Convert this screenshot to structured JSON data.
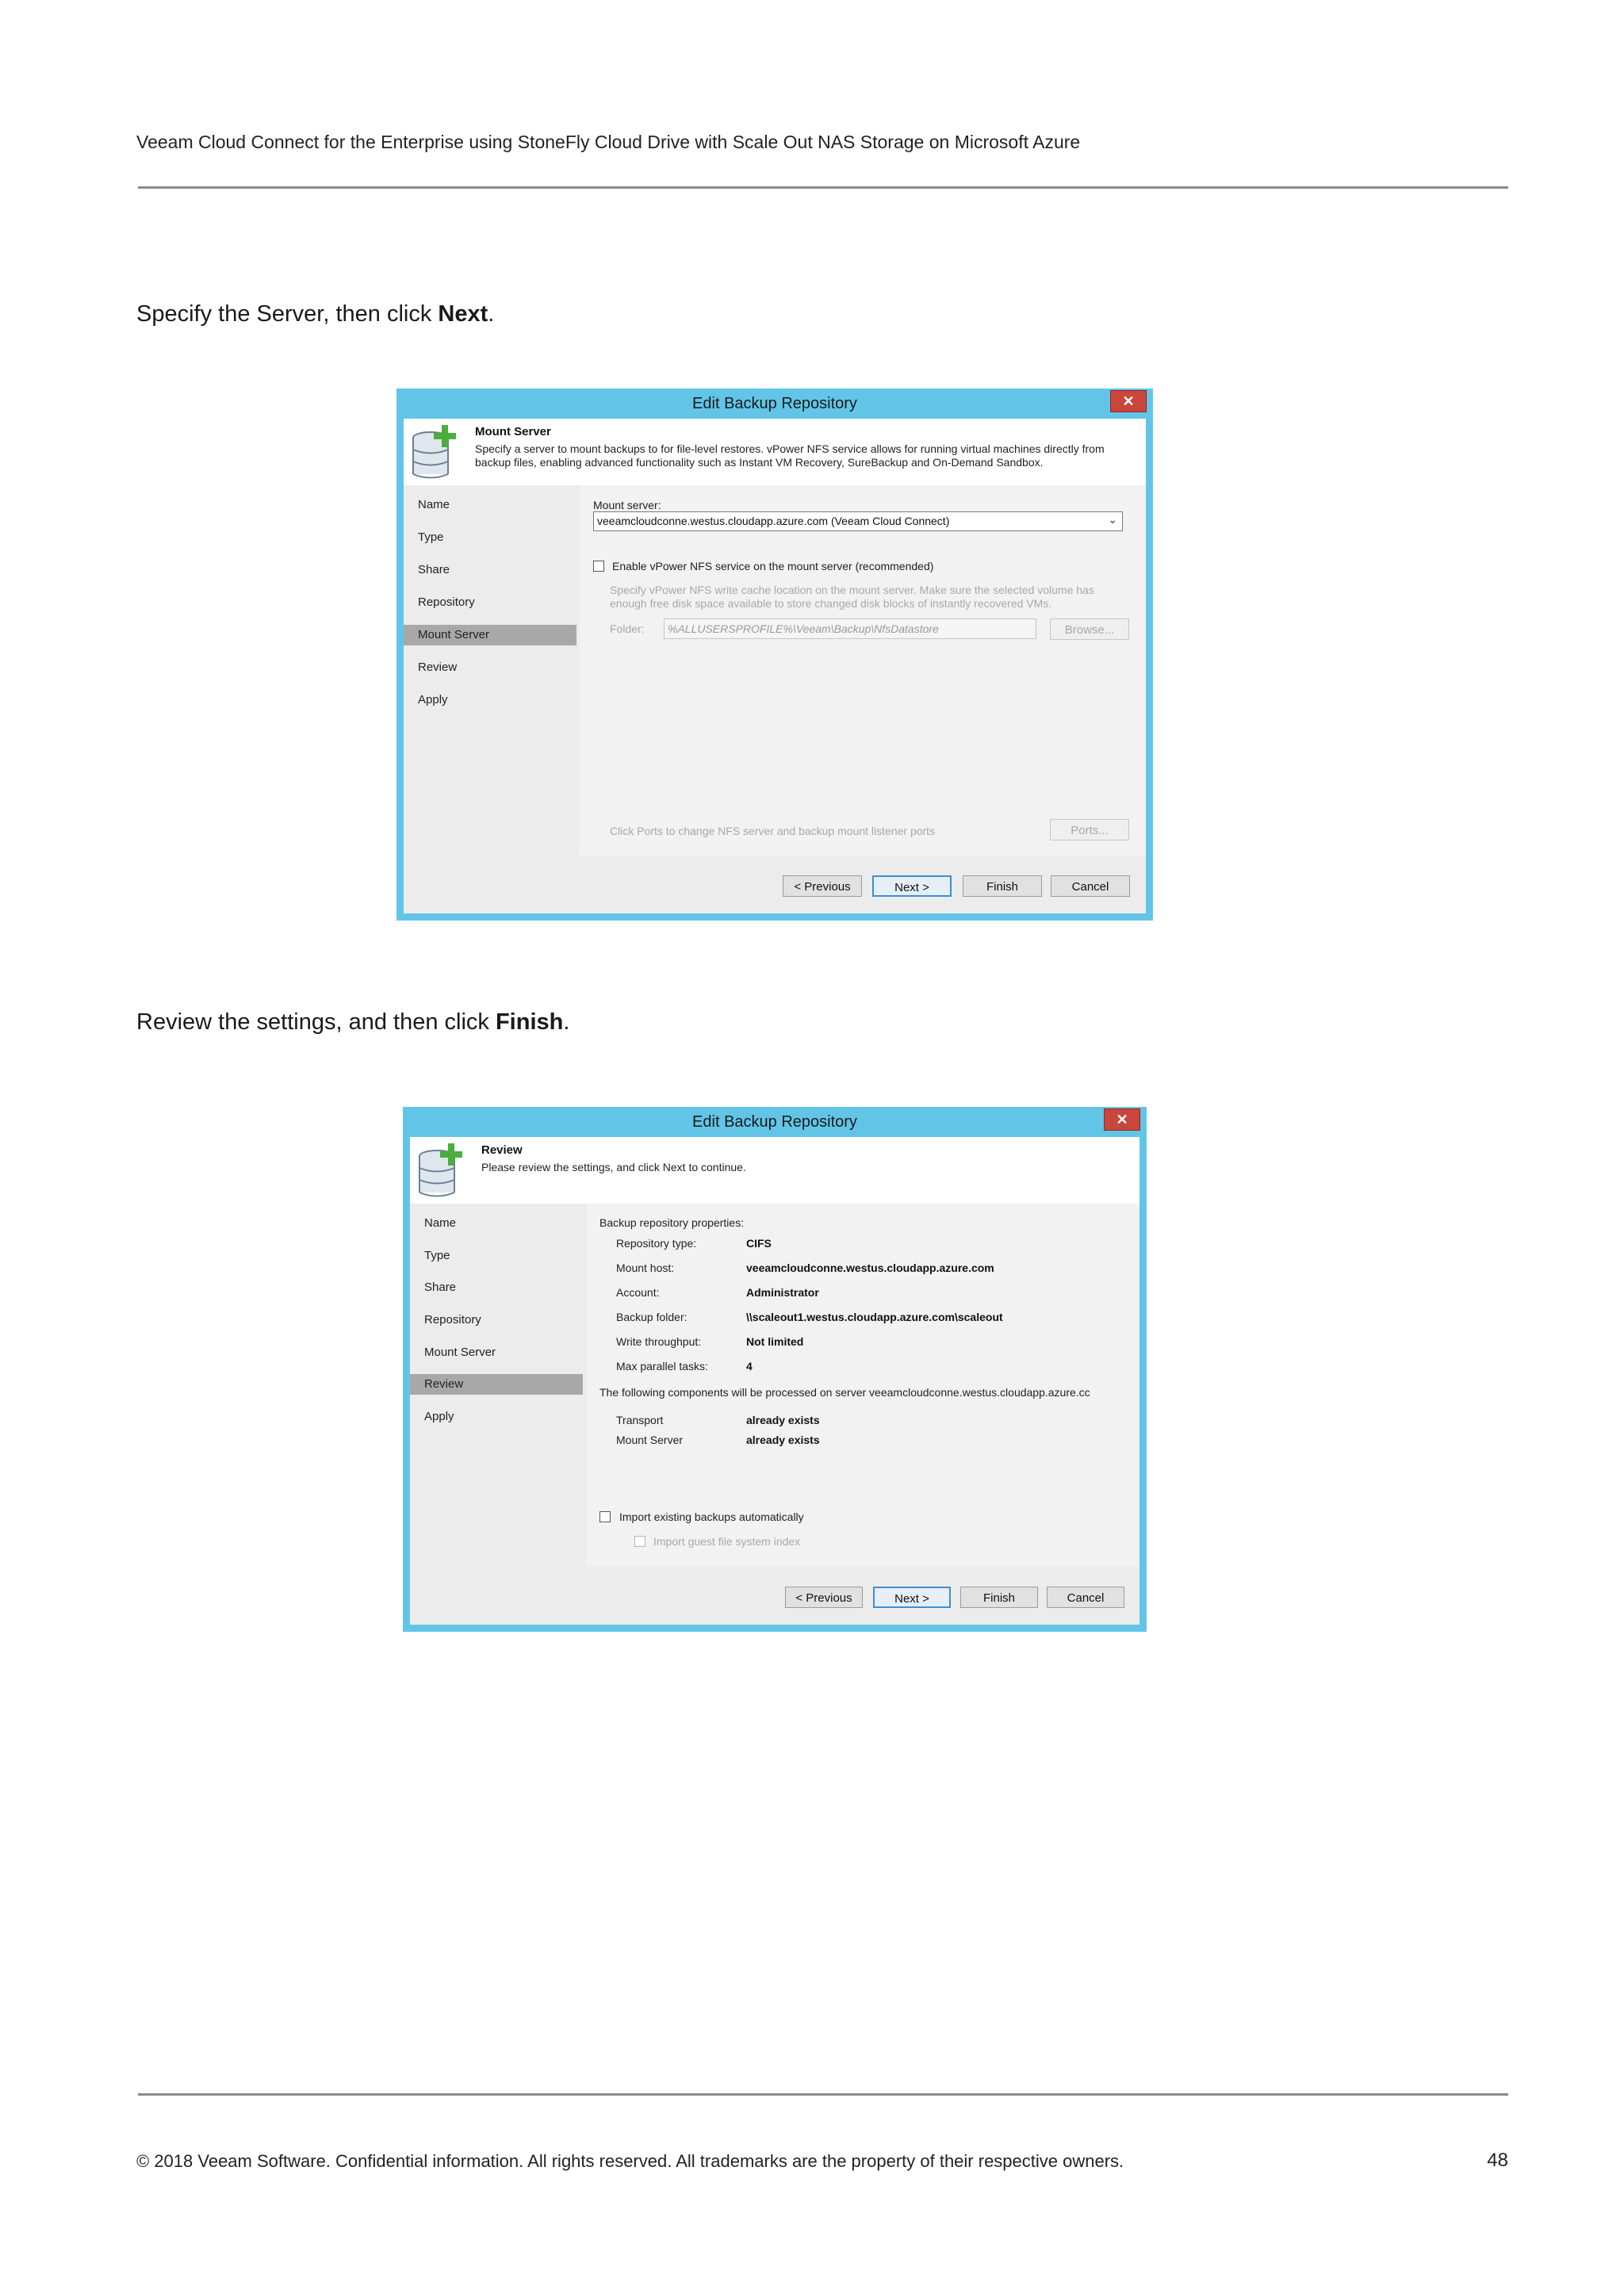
{
  "document": {
    "header": "Veeam Cloud Connect for the Enterprise using StoneFly Cloud Drive with Scale Out NAS Storage on Microsoft Azure",
    "step1": {
      "text": "Specify the Server, then click ",
      "bold": "Next",
      "end": "."
    },
    "step2": {
      "text": "Review the settings, and then click ",
      "bold": "Finish",
      "end": "."
    },
    "footer": "© 2018 Veeam Software. Confidential information. All rights reserved. All trademarks are the property of their respective owners.",
    "page_number": "48"
  },
  "dialog1": {
    "title": "Edit Backup Repository",
    "close": "✕",
    "header_title": "Mount Server",
    "header_desc": "Specify a server to mount backups to for file-level restores. vPower NFS service allows for running virtual machines directly from backup files, enabling advanced functionality such as Instant VM Recovery, SureBackup and On-Demand Sandbox.",
    "steps": [
      "Name",
      "Type",
      "Share",
      "Repository",
      "Mount Server",
      "Review",
      "Apply"
    ],
    "mount_server_label": "Mount server:",
    "mount_server_value": "veeamcloudconne.westus.cloudapp.azure.com (Veeam Cloud Connect)",
    "nfs_checkbox_label": "Enable vPower NFS service on the mount server (recommended)",
    "nfs_note": "Specify vPower NFS write cache location on the mount server. Make sure the selected volume has enough free disk space available to store changed disk blocks of instantly recovered VMs.",
    "folder_label": "Folder:",
    "folder_value": "%ALLUSERSPROFILE%\\Veeam\\Backup\\NfsDatastore",
    "browse": "Browse...",
    "ports_note": "Click Ports to change NFS server and backup mount listener ports",
    "ports": "Ports...",
    "buttons": {
      "previous": "< Previous",
      "next": "Next >",
      "finish": "Finish",
      "cancel": "Cancel"
    }
  },
  "dialog2": {
    "title": "Edit Backup Repository",
    "close": "✕",
    "header_title": "Review",
    "header_desc": "Please review the settings, and click Next to continue.",
    "steps": [
      "Name",
      "Type",
      "Share",
      "Repository",
      "Mount Server",
      "Review",
      "Apply"
    ],
    "properties_heading": "Backup repository properties:",
    "properties": [
      {
        "label": "Repository type:",
        "value": "CIFS"
      },
      {
        "label": "Mount host:",
        "value": "veeamcloudconne.westus.cloudapp.azure.com"
      },
      {
        "label": "Account:",
        "value": "Administrator"
      },
      {
        "label": "Backup folder:",
        "value": "\\\\scaleout1.westus.cloudapp.azure.com\\scaleout"
      },
      {
        "label": "Write throughput:",
        "value": "Not limited"
      },
      {
        "label": "Max parallel tasks:",
        "value": "4"
      }
    ],
    "components_heading": "The following components will be processed on server veeamcloudconne.westus.cloudapp.azure.cc",
    "components": [
      {
        "label": "Transport",
        "value": "already exists"
      },
      {
        "label": "Mount Server",
        "value": "already exists"
      }
    ],
    "import_label": "Import existing backups automatically",
    "guest_index_label": "Import guest file system index",
    "buttons": {
      "previous": "< Previous",
      "next": "Next >",
      "finish": "Finish",
      "cancel": "Cancel"
    }
  }
}
